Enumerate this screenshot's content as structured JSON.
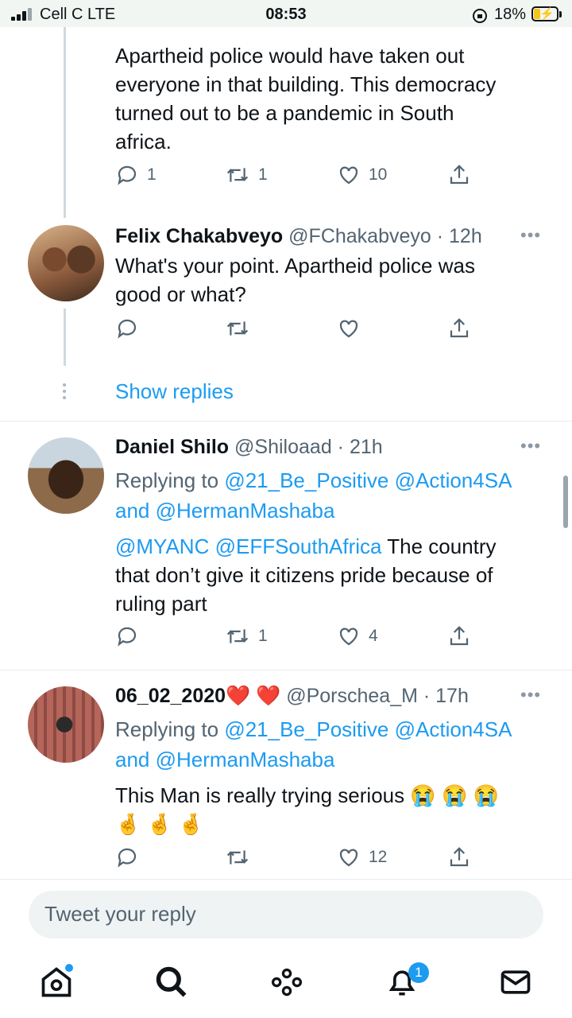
{
  "status_bar": {
    "carrier": "Cell C  LTE",
    "time": "08:53",
    "battery_percent": "18%",
    "battery_level": 0.18
  },
  "tweets": [
    {
      "id": "t1",
      "text_lines": [
        "Apartheid police would have taken out",
        "everyone in that building. This democracy",
        "turned out to be a pandemic in South",
        "africa."
      ],
      "replies": "1",
      "retweets": "1",
      "likes": "10"
    },
    {
      "id": "t2",
      "name": "Felix Chakabveyo",
      "handle": "@FChakabveyo · 12h",
      "text_lines": [
        "What's your point. Apartheid police was",
        "good or what?"
      ],
      "replies": "",
      "retweets": "",
      "likes": ""
    },
    {
      "id": "t3",
      "name": "Daniel Shilo",
      "handle": "@Shiloaad · 21h",
      "replying_prefix": "Replying to",
      "replying_line1": "@21_Be_Positive @Action4SA",
      "replying_line2": "and @HermanMashaba",
      "mentions": "@MYANC @EFFSouthAfrica",
      "text_after_mentions": " The country",
      "text_lines": [
        "that don’t give it citizens pride because of",
        "ruling part"
      ],
      "replies": "",
      "retweets": "1",
      "likes": "4"
    },
    {
      "id": "t4",
      "name": "06_02_2020",
      "name_emoji": "❤️ ❤️",
      "handle": "@Porschea_M · 17h",
      "replying_prefix": "Replying to",
      "replying_line1": "@21_Be_Positive @Action4SA",
      "replying_line2": "and @HermanMashaba",
      "text_line1": "This Man is really trying serious",
      "text_emoji1": "😭 😭 😭",
      "text_emoji2": "🤞 🤞 🤞",
      "replies": "",
      "retweets": "",
      "likes": "12"
    }
  ],
  "show_replies": "Show replies",
  "reply_box": {
    "placeholder": "Tweet your reply"
  },
  "tabbar": {
    "notifications_badge": "1"
  },
  "colors": {
    "accent": "#1d9bf0",
    "secondary_text": "#536471",
    "divider": "#e6ecf0"
  },
  "icons": [
    "reply-icon",
    "retweet-icon",
    "like-icon",
    "share-icon",
    "more-icon",
    "home-icon",
    "search-icon",
    "spaces-icon",
    "notifications-icon",
    "messages-icon"
  ]
}
